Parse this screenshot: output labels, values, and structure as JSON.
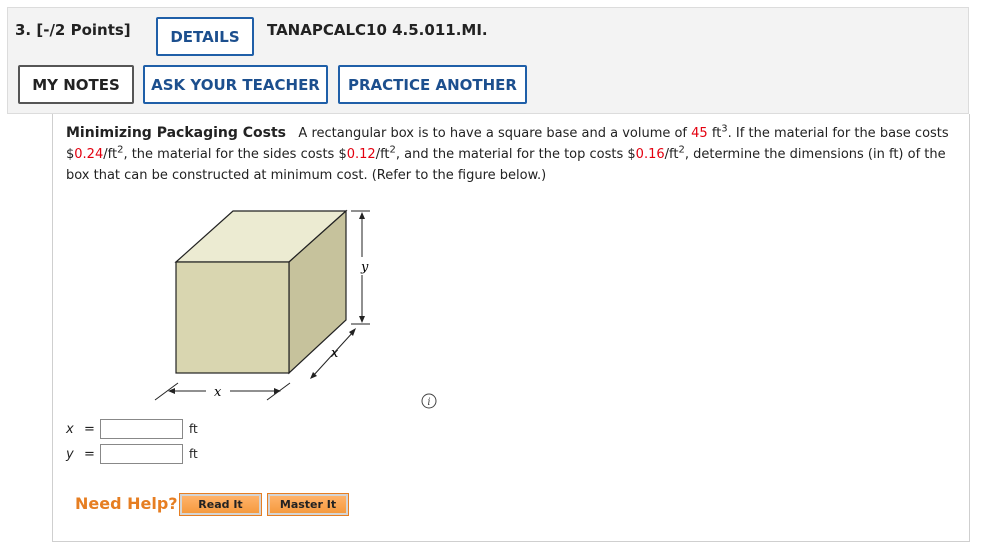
{
  "header": {
    "question_label": "3. [-/2 Points]",
    "details_label": "DETAILS",
    "code": "TANAPCALC10 4.5.011.MI.",
    "my_notes_label": "MY NOTES",
    "ask_teacher_label": "ASK YOUR TEACHER",
    "practice_label": "PRACTICE ANOTHER"
  },
  "problem": {
    "title": "Minimizing Packaging Costs",
    "t1": "A rectangular box is to have a square base and a volume of",
    "volume": "45",
    "t2": "ft",
    "t3": ". If the material for the base costs $",
    "base_cost": "0.24",
    "t4": "/ft",
    "t5": ", the material for the sides costs $",
    "side_cost": "0.12",
    "t6": "/ft",
    "t7": ", and the material for the top costs $",
    "top_cost": "0.16",
    "t8": "/ft",
    "t9": ", determine the dimensions (in ft) of the box that can be constructed at minimum cost. (Refer to the figure below.)",
    "exp3": "3",
    "exp2": "2"
  },
  "figure": {
    "label_y": "y",
    "label_x_side": "x",
    "label_x_bottom": "x"
  },
  "answers": {
    "x_label": "x",
    "y_label": "y",
    "equals": "=",
    "x_value": "",
    "y_value": "",
    "unit": "ft"
  },
  "help": {
    "need_help": "Need Help?",
    "read_it": "Read It",
    "master_it": "Master It"
  },
  "colors": {
    "accent": "#1f5fa8",
    "red": "#e3000f",
    "orange": "#e67e22",
    "box_face": "#d9d6b0"
  }
}
